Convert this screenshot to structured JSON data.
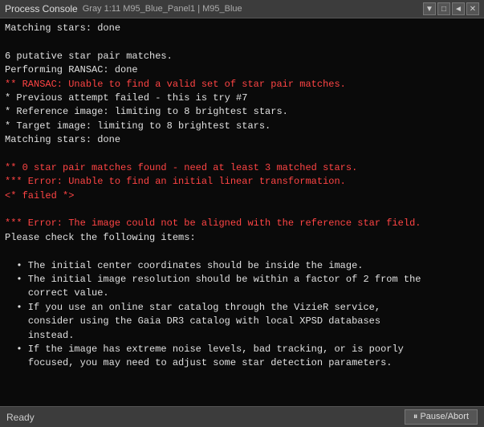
{
  "titleBar": {
    "title": "Process Console",
    "info": "Gray 1:11 M95_Blue_Panel1 | M95_Blue",
    "controls": [
      "▼",
      "□",
      "◄",
      "✕"
    ]
  },
  "console": {
    "lines": [
      {
        "type": "normal",
        "text": "Matching stars: done"
      },
      {
        "type": "blank"
      },
      {
        "type": "normal",
        "text": "6 putative star pair matches."
      },
      {
        "type": "normal",
        "text": "Performing RANSAC: done"
      },
      {
        "type": "error-red",
        "text": "** RANSAC: Unable to find a valid set of star pair matches."
      },
      {
        "type": "normal",
        "text": "* Previous attempt failed - this is try #7"
      },
      {
        "type": "normal",
        "text": "* Reference image: limiting to 8 brightest stars."
      },
      {
        "type": "normal",
        "text": "* Target image: limiting to 8 brightest stars."
      },
      {
        "type": "normal",
        "text": "Matching stars: done"
      },
      {
        "type": "blank"
      },
      {
        "type": "error-red",
        "text": "** 0 star pair matches found - need at least 3 matched stars."
      },
      {
        "type": "error-red",
        "text": "*** Error: Unable to find an initial linear transformation."
      },
      {
        "type": "error-red",
        "text": "<* failed *>"
      },
      {
        "type": "blank"
      },
      {
        "type": "error-red",
        "text": "*** Error: The image could not be aligned with the reference star field."
      },
      {
        "type": "normal",
        "text": "Please check the following items:"
      },
      {
        "type": "blank"
      },
      {
        "type": "bullet",
        "text": "  • The initial center coordinates should be inside the image."
      },
      {
        "type": "bullet",
        "text": "  • The initial image resolution should be within a factor of 2 from the\n    correct value."
      },
      {
        "type": "bullet",
        "text": "  • If you use an online star catalog through the VizieR service,\n    consider using the Gaia DR3 catalog with local XPSD databases\n    instead."
      },
      {
        "type": "bullet",
        "text": "  • If the image has extreme noise levels, bad tracking, or is poorly\n    focused, you may need to adjust some star detection parameters."
      }
    ]
  },
  "bottomBar": {
    "status": "Ready",
    "pauseAbortLabel": "⏸ Pause/Abort"
  }
}
